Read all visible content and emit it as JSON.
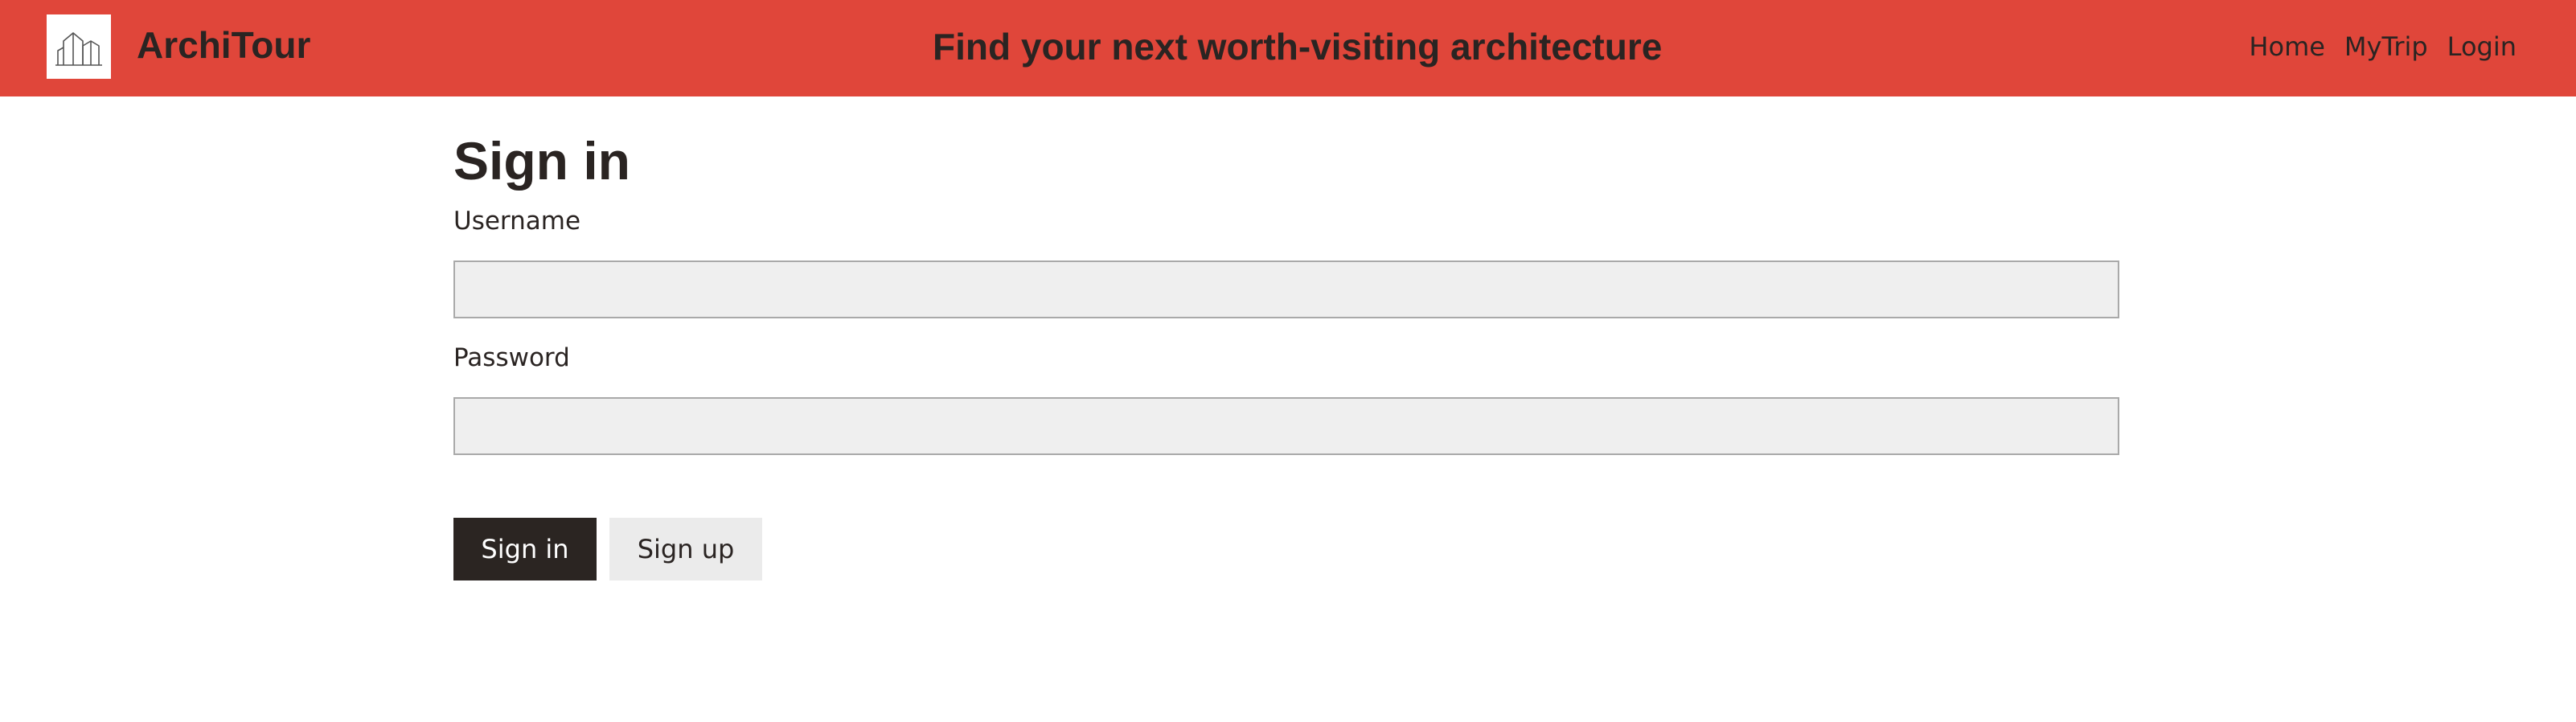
{
  "header": {
    "brand": "ArchiTour",
    "tagline": "Find your next worth-visiting architecture",
    "nav": {
      "home": "Home",
      "mytrip": "MyTrip",
      "login": "Login"
    },
    "logo_icon": "buildings-icon",
    "colors": {
      "bar": "#e0463a",
      "text": "#2a2422"
    }
  },
  "signin": {
    "title": "Sign in",
    "username_label": "Username",
    "username_value": "",
    "password_label": "Password",
    "password_value": "",
    "signin_button": "Sign in",
    "signup_button": "Sign up",
    "colors": {
      "primary_button": "#2b2522",
      "secondary_button": "#ebebeb",
      "field_background": "#efefef"
    }
  }
}
